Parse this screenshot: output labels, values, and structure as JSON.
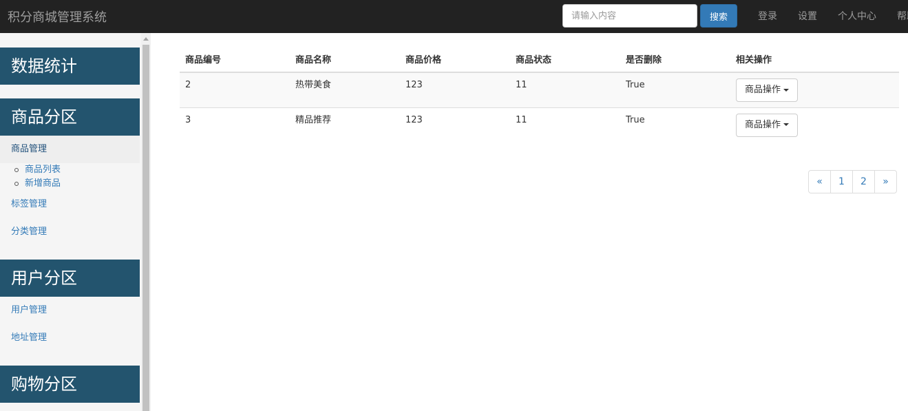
{
  "navbar": {
    "brand": "积分商城管理系统",
    "search_placeholder": "请输入内容",
    "search_button": "搜索",
    "links": [
      "登录",
      "设置",
      "个人中心",
      "帮助"
    ]
  },
  "sidebar": {
    "sections": [
      "数据统计",
      "商品分区",
      "用户分区",
      "购物分区"
    ],
    "goods_items": {
      "manage": "商品管理",
      "tags": "标签管理",
      "category": "分类管理"
    },
    "goods_sub": [
      "商品列表",
      "新增商品"
    ],
    "user_items": {
      "manage": "用户管理",
      "address": "地址管理"
    }
  },
  "table": {
    "headers": [
      "商品编号",
      "商品名称",
      "商品价格",
      "商品状态",
      "是否删除",
      "相关操作"
    ],
    "rows": [
      {
        "id": "2",
        "name": "热带美食",
        "price": "123",
        "status": "11",
        "deleted": "True",
        "action": "商品操作"
      },
      {
        "id": "3",
        "name": "精品推荐",
        "price": "123",
        "status": "11",
        "deleted": "True",
        "action": "商品操作"
      }
    ]
  },
  "pagination": {
    "prev": "«",
    "pages": [
      "1",
      "2"
    ],
    "next": "»"
  },
  "colors": {
    "navbar": "#222222",
    "sidebar_header": "#23546e",
    "link": "#337ab7",
    "primary_button": "#337ab7"
  }
}
